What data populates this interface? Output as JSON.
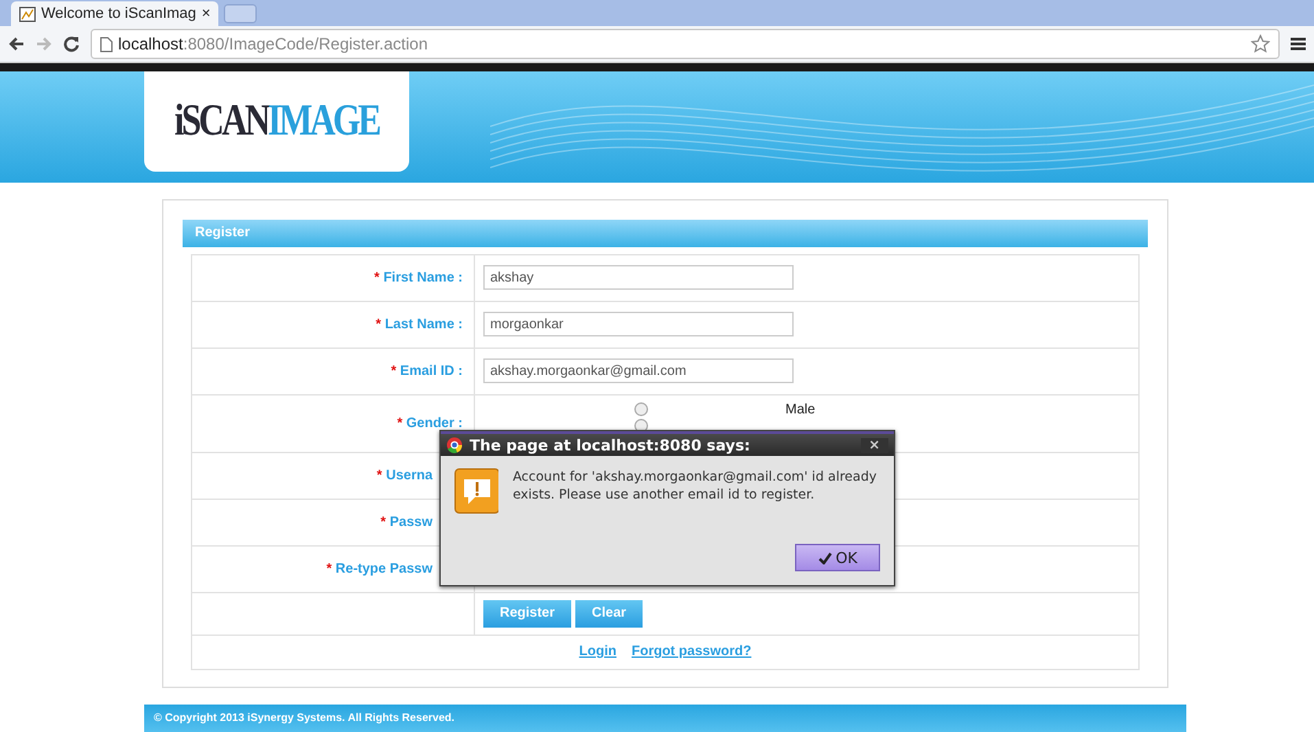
{
  "browser": {
    "tab": {
      "title": "Welcome to iScanImag",
      "close": "×"
    },
    "url": {
      "host": "localhost",
      "path": ":8080/ImageCode/Register.action"
    }
  },
  "logo": {
    "part1": "iSCAN",
    "part2": "IMAGE"
  },
  "form": {
    "title": "Register",
    "fields": [
      {
        "kind": "text",
        "marker": "*",
        "label": "First Name :",
        "value": "akshay"
      },
      {
        "kind": "text",
        "marker": "*",
        "label": "Last Name :",
        "value": "morgaonkar"
      },
      {
        "kind": "text",
        "marker": "*",
        "label": "Email ID :",
        "value": "akshay.morgaonkar@gmail.com"
      },
      {
        "kind": "radio",
        "marker": "*",
        "label": "Gender :",
        "options": [
          {
            "label": "Male",
            "selected": false
          },
          {
            "selected": false
          }
        ]
      },
      {
        "kind": "covered",
        "marker": "*",
        "label": "Userna"
      },
      {
        "kind": "covered",
        "marker": "*",
        "label": "Passw"
      },
      {
        "kind": "covered",
        "marker": "*",
        "label": "Re-type Passw"
      }
    ],
    "buttons": [
      "Register",
      "Clear"
    ],
    "links": [
      "Login",
      "Forgot password?"
    ]
  },
  "footer": "© Copyright 2013 iSynergy Systems. All Rights Reserved.",
  "dialog": {
    "title": "The page at localhost:8080 says:",
    "close": "×",
    "message": "Account for 'akshay.morgaonkar@gmail.com' id already exists. Please use another email id to register.",
    "button": "OK"
  }
}
